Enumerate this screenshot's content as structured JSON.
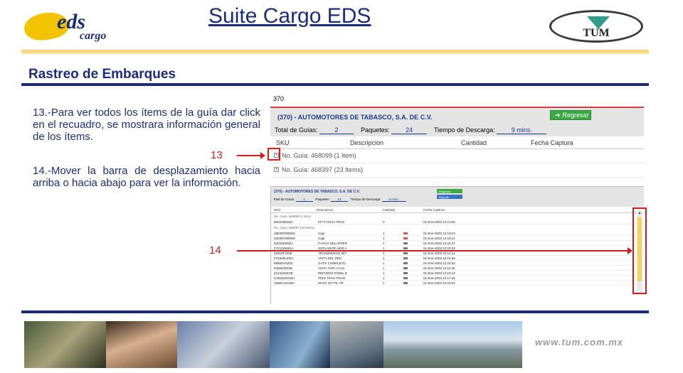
{
  "header": {
    "logo_eds": "eds",
    "logo_cargo": "cargo",
    "title": "Suite Cargo EDS",
    "logo_tum": "TUM"
  },
  "section": {
    "title": "Rastreo de Embarques"
  },
  "instructions": {
    "step13": "13.-Para ver todos los ítems de la guía dar click en el recuadro, se mostrara información general de los ítems.",
    "step14": "14.-Mover la barra de desplazamiento hacia arriba o hacia abajo para ver la información."
  },
  "callouts": {
    "n13": "13",
    "n14": "14"
  },
  "app": {
    "top_label": "370",
    "company": "(370) - AUTOMOTORES DE TABASCO, S.A. DE C.V.",
    "regresar": "Regresar",
    "reporte": "Reporte",
    "total_label": "Total de Guías:",
    "total_value": "2",
    "paquetes_label": "Paquetes:",
    "paquetes_value": "24",
    "tiempo_label": "Tiempo de Descarga:",
    "tiempo_value": "9 mins.",
    "columns": {
      "sku": "SKU",
      "descripcion": "Descripcion",
      "cantidad": "Cantidad",
      "fecha": "Fecha Captura"
    },
    "guias": [
      {
        "label": "No. Guía: 468099 (1 Item)"
      },
      {
        "label": "No. Guía: 468397 (23 Items)"
      }
    ],
    "mini_guia1_item": {
      "sku": "850229KM0J",
      "desc": "KIT FASCIA TRAS",
      "cant": "3",
      "fecha": "01-Ene-2003 12:13:00"
    },
    "mini_rows": [
      {
        "sku": "468397000001",
        "desc": "Caja",
        "cant": "1",
        "fecha": "01-Ene-2003 12:19:23"
      },
      {
        "sku": "468397000002",
        "desc": "Caja",
        "cant": "1",
        "fecha": "01-Ene-2003 12:19:24"
      },
      {
        "sku": "62022EM30J",
        "desc": "FASCIA DELANTER",
        "cant": "1",
        "fecha": "01-Ene-2003 12:16:37"
      },
      {
        "sku": "27210ZW81A",
        "desc": "SOPLADOR AIRE A",
        "cant": "1",
        "fecha": "01-Ene-2003 12:15:33"
      },
      {
        "sku": "32010F4208",
        "desc": "TRANSMISION M/T",
        "cant": "1",
        "fecha": "01-Ene-2003 12:12:11"
      },
      {
        "sku": "F31000LEMA",
        "desc": "VISTA DEL DER",
        "cant": "1",
        "fecha": "01-Ene-2003 12:15:59"
      },
      {
        "sku": "99550VN20C",
        "desc": "GATO COMPLETO",
        "cant": "1",
        "fecha": "01-Ene-2003 12:15:02"
      },
      {
        "sku": "84966350SB",
        "desc": "VISTA TAPA CAJU",
        "cant": "1",
        "fecha": "01-Ene-2003 12:10:30"
      },
      {
        "sku": "612403XE2B",
        "desc": "REFUERZ PANEL D",
        "cant": "1",
        "fecha": "01-Ene-2003 12:10:12"
      },
      {
        "sku": "G45333SGMA",
        "desc": "PISO TRAS-TRAS/",
        "cant": "1",
        "fecha": "01-Ene-2003 12:17:45"
      },
      {
        "sku": "G86673SGMA",
        "desc": "RFZO INT PIL TR",
        "cant": "1",
        "fecha": "01-Ene-2003 12:19:02"
      }
    ]
  },
  "footer": {
    "website": "www.tum.com.mx"
  },
  "colors": {
    "brand_blue": "#1c2c7c",
    "accent_red": "#d21b1b",
    "button_green": "#3aa843"
  }
}
